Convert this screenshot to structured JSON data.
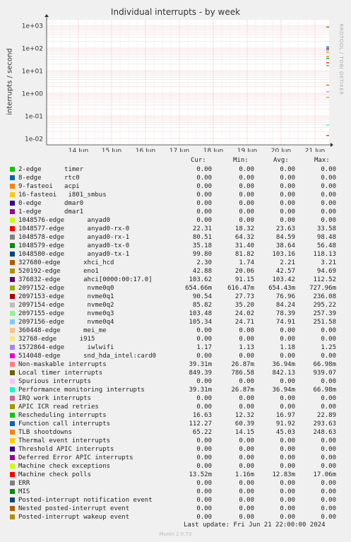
{
  "title": "Individual interrupts - by week",
  "side_text": "RRDTOOL / TOBI OETIKER",
  "footer": "Munin 2.0.73",
  "last_update": "Last update: Fri Jun 21 22:00:00 2024",
  "columns": {
    "cur": "Cur:",
    "min": "Min:",
    "avg": "Avg:",
    "max": "Max:"
  },
  "chart_data": {
    "type": "line",
    "title": "Individual interrupts - by week",
    "ylabel": "interrupts / second",
    "yscale": "log",
    "ylim": [
      0.005,
      2000
    ],
    "yticks": [
      0.01,
      0.1,
      1,
      10,
      100,
      1000
    ],
    "ytick_labels": [
      "1e-02",
      "1e-01",
      "1e+00",
      "1e+01",
      "1e+02",
      "1e+03"
    ],
    "xticks": [
      "14 Jun",
      "15 Jun",
      "16 Jun",
      "17 Jun",
      "18 Jun",
      "19 Jun",
      "20 Jun",
      "21 Jun"
    ],
    "grid": true,
    "note": "data only present in final hours of Jun 21",
    "series": [
      {
        "name": "2-edge      timer",
        "color": "#00cc00",
        "cur": "0.00",
        "min": "0.00",
        "avg": "0.00",
        "max": "0.00"
      },
      {
        "name": "8-edge      rtc0",
        "color": "#0066b3",
        "cur": "0.00",
        "min": "0.00",
        "avg": "0.00",
        "max": "0.00"
      },
      {
        "name": "9-fasteoi   acpi",
        "color": "#ff8000",
        "cur": "0.00",
        "min": "0.00",
        "avg": "0.00",
        "max": "0.00"
      },
      {
        "name": "16-fasteoi   i801_smbus",
        "color": "#ffcc00",
        "cur": "0.00",
        "min": "0.00",
        "avg": "0.00",
        "max": "0.00"
      },
      {
        "name": "0-edge      dmar0",
        "color": "#330099",
        "cur": "0.00",
        "min": "0.00",
        "avg": "0.00",
        "max": "0.00"
      },
      {
        "name": "1-edge      dmar1",
        "color": "#990099",
        "cur": "0.00",
        "min": "0.00",
        "avg": "0.00",
        "max": "0.00"
      },
      {
        "name": "1048576-edge      anyad0",
        "color": "#ccff00",
        "cur": "0.00",
        "min": "0.00",
        "avg": "0.00",
        "max": "0.00"
      },
      {
        "name": "1048577-edge      anyad0-rx-0",
        "color": "#ff0000",
        "cur": "22.31",
        "min": "18.32",
        "avg": "23.63",
        "max": "33.58"
      },
      {
        "name": "1048578-edge      anyad0-rx-1",
        "color": "#808080",
        "cur": "80.51",
        "min": "64.32",
        "avg": "84.59",
        "max": "98.48"
      },
      {
        "name": "1048579-edge      anyad0-tx-0",
        "color": "#008f00",
        "cur": "35.18",
        "min": "31.40",
        "avg": "38.64",
        "max": "56.48"
      },
      {
        "name": "1048580-edge      anyad0-tx-1",
        "color": "#00487d",
        "cur": "99.80",
        "min": "81.82",
        "avg": "103.16",
        "max": "118.13"
      },
      {
        "name": "327680-edge      xhci_hcd",
        "color": "#b35a00",
        "cur": "2.30",
        "min": "1.74",
        "avg": "2.21",
        "max": "3.21"
      },
      {
        "name": "520192-edge      eno1",
        "color": "#b38f00",
        "cur": "42.88",
        "min": "20.06",
        "avg": "42.57",
        "max": "94.69"
      },
      {
        "name": "376832-edge      ahci[0000:00:17.0]",
        "color": "#6b006b",
        "cur": "103.62",
        "min": "91.15",
        "avg": "103.42",
        "max": "112.52"
      },
      {
        "name": "2097152-edge      nvme0q0",
        "color": "#8fb300",
        "cur": "654.66m",
        "min": "616.47m",
        "avg": "654.43m",
        "max": "727.96m"
      },
      {
        "name": "2097153-edge      nvme0q1",
        "color": "#b30000",
        "cur": "90.54",
        "min": "27.73",
        "avg": "76.96",
        "max": "236.08"
      },
      {
        "name": "2097154-edge      nvme0q2",
        "color": "#bebebe",
        "cur": "85.82",
        "min": "35.20",
        "avg": "84.24",
        "max": "295.22"
      },
      {
        "name": "2097155-edge      nvme0q3",
        "color": "#80ff80",
        "cur": "103.48",
        "min": "24.02",
        "avg": "78.39",
        "max": "257.39"
      },
      {
        "name": "2097156-edge      nvme0q4",
        "color": "#80c9ff",
        "cur": "105.34",
        "min": "24.71",
        "avg": "74.91",
        "max": "251.58"
      },
      {
        "name": "360448-edge      mei_me",
        "color": "#ffc080",
        "cur": "0.00",
        "min": "0.00",
        "avg": "0.00",
        "max": "0.00"
      },
      {
        "name": "32768-edge      i915",
        "color": "#ffe680",
        "cur": "0.00",
        "min": "0.00",
        "avg": "0.00",
        "max": "0.00"
      },
      {
        "name": "1572864-edge      iwlwifi",
        "color": "#aa80ff",
        "cur": "1.17",
        "min": "1.13",
        "avg": "1.18",
        "max": "1.25"
      },
      {
        "name": "514048-edge      snd_hda_intel:card0",
        "color": "#ee00cc",
        "cur": "0.00",
        "min": "0.00",
        "avg": "0.00",
        "max": "0.00"
      },
      {
        "name": "Non-maskable interrupts",
        "color": "#ff8080",
        "cur": "39.31m",
        "min": "26.87m",
        "avg": "36.94m",
        "max": "66.98m"
      },
      {
        "name": "Local timer interrupts",
        "color": "#666600",
        "cur": "849.39",
        "min": "786.58",
        "avg": "842.13",
        "max": "939.07"
      },
      {
        "name": "Spurious interrupts",
        "color": "#ffbfff",
        "cur": "0.00",
        "min": "0.00",
        "avg": "0.00",
        "max": "0.00"
      },
      {
        "name": "Performance monitoring interrupts",
        "color": "#00ffcc",
        "cur": "39.31m",
        "min": "26.87m",
        "avg": "36.94m",
        "max": "66.98m"
      },
      {
        "name": "IRQ work interrupts",
        "color": "#cc6699",
        "cur": "0.00",
        "min": "0.00",
        "avg": "0.00",
        "max": "0.00"
      },
      {
        "name": "APIC ICR read retries",
        "color": "#999900",
        "cur": "0.00",
        "min": "0.00",
        "avg": "0.00",
        "max": "0.00"
      },
      {
        "name": "Rescheduling interrupts",
        "color": "#00cc00",
        "cur": "16.63",
        "min": "12.32",
        "avg": "16.97",
        "max": "22.89"
      },
      {
        "name": "Function call interrupts",
        "color": "#0066b3",
        "cur": "112.27",
        "min": "60.39",
        "avg": "91.92",
        "max": "293.63"
      },
      {
        "name": "TLB shootdowns",
        "color": "#ff8000",
        "cur": "65.22",
        "min": "14.15",
        "avg": "45.03",
        "max": "248.63"
      },
      {
        "name": "Thermal event interrupts",
        "color": "#ffcc00",
        "cur": "0.00",
        "min": "0.00",
        "avg": "0.00",
        "max": "0.00"
      },
      {
        "name": "Threshold APIC interrupts",
        "color": "#330099",
        "cur": "0.00",
        "min": "0.00",
        "avg": "0.00",
        "max": "0.00"
      },
      {
        "name": "Deferred Error APIC interrupts",
        "color": "#990099",
        "cur": "0.00",
        "min": "0.00",
        "avg": "0.00",
        "max": "0.00"
      },
      {
        "name": "Machine check exceptions",
        "color": "#ccff00",
        "cur": "0.00",
        "min": "0.00",
        "avg": "0.00",
        "max": "0.00"
      },
      {
        "name": "Machine check polls",
        "color": "#ff0000",
        "cur": "13.52m",
        "min": "1.16m",
        "avg": "12.83m",
        "max": "17.06m"
      },
      {
        "name": "ERR",
        "color": "#808080",
        "cur": "0.00",
        "min": "0.00",
        "avg": "0.00",
        "max": "0.00"
      },
      {
        "name": "MIS",
        "color": "#008f00",
        "cur": "0.00",
        "min": "0.00",
        "avg": "0.00",
        "max": "0.00"
      },
      {
        "name": "Posted-interrupt notification event",
        "color": "#00487d",
        "cur": "0.00",
        "min": "0.00",
        "avg": "0.00",
        "max": "0.00"
      },
      {
        "name": "Nested posted-interrupt event",
        "color": "#b35a00",
        "cur": "0.00",
        "min": "0.00",
        "avg": "0.00",
        "max": "0.00"
      },
      {
        "name": "Posted-interrupt wakeup event",
        "color": "#b38f00",
        "cur": "0.00",
        "min": "0.00",
        "avg": "0.00",
        "max": "0.00"
      }
    ]
  }
}
